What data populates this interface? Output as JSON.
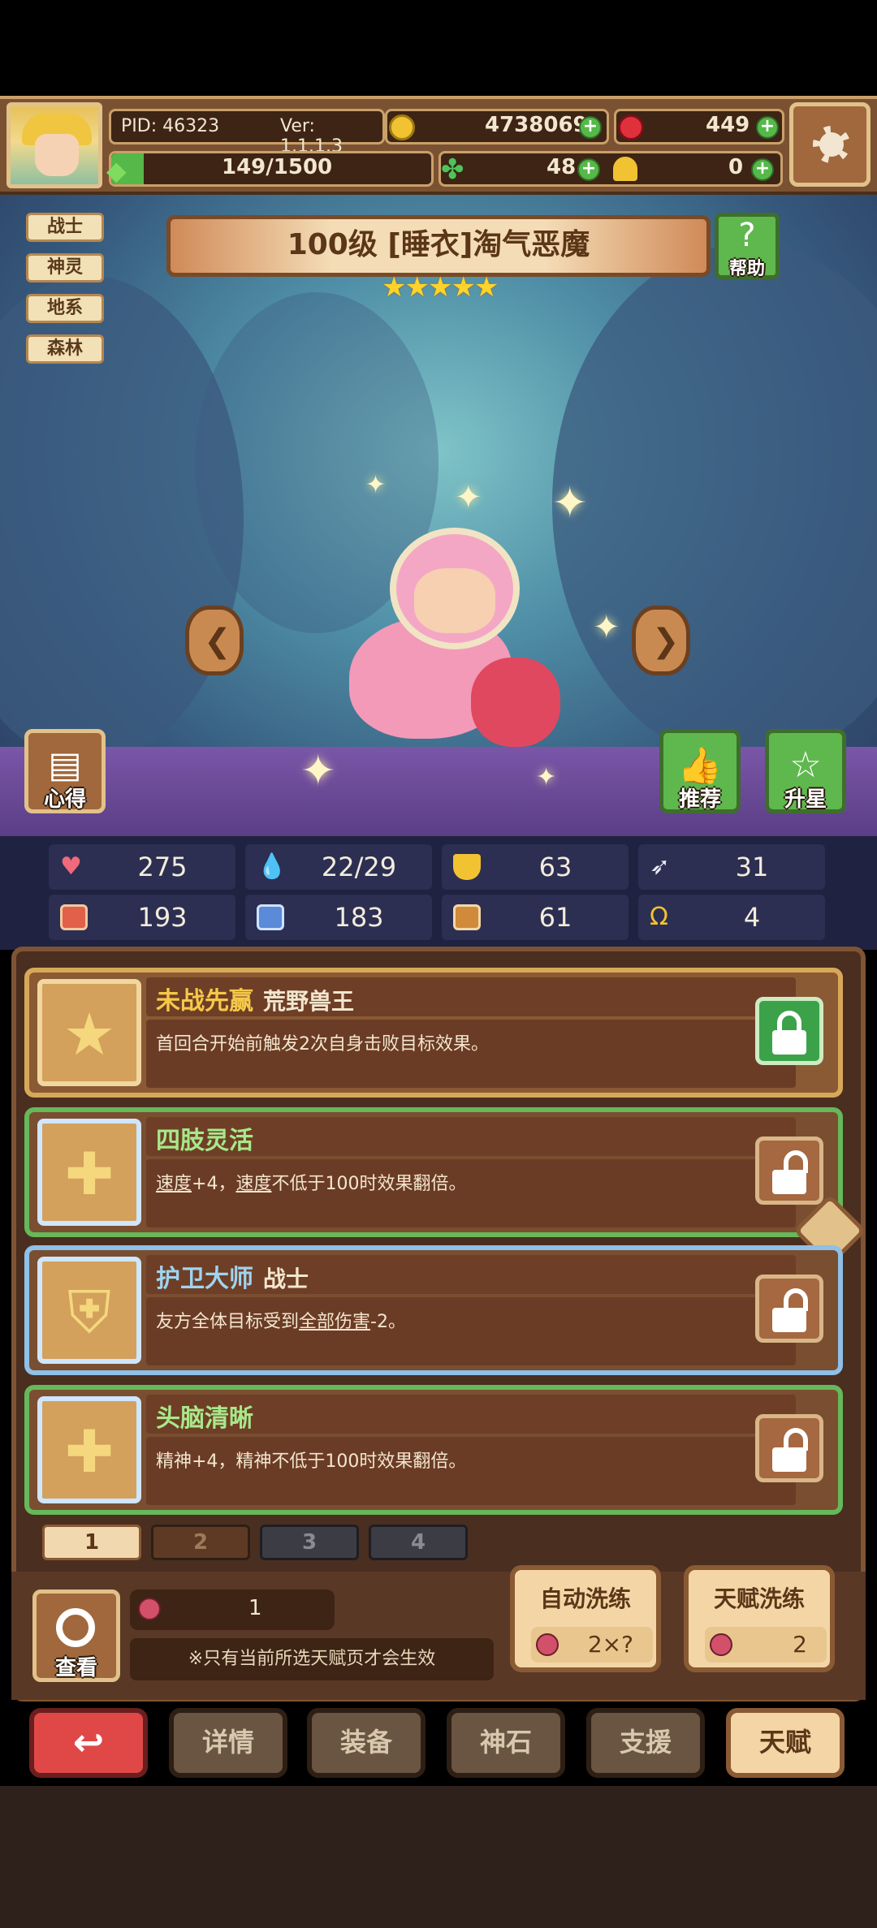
{
  "status": {
    "pid": "PID: 46323",
    "version": "Ver: 1.1.1.3",
    "gold": "4738069",
    "gems": "449",
    "stamina": "149/1500",
    "clover": "48",
    "key": "0"
  },
  "tags": [
    "战士",
    "神灵",
    "地系",
    "森林"
  ],
  "hero": {
    "title": "100级  [睡衣]淘气恶魔",
    "stars": "★★★★★"
  },
  "buttons": {
    "help": "帮助",
    "tips": "心得",
    "recommend": "推荐",
    "star_up": "升星",
    "view": "查看"
  },
  "stats": {
    "hp": "275",
    "mana": "22/29",
    "defense": "63",
    "speed": "31",
    "attack": "193",
    "spirit": "183",
    "magic_def": "61",
    "crit": "4"
  },
  "talents": [
    {
      "name": "未战先赢",
      "sub": "荒野兽王",
      "desc": "首回合开始前触发2次自身击败目标效果。",
      "name_color": "#f5c84a"
    },
    {
      "name": "四肢灵活",
      "sub": "",
      "desc_parts": [
        "速度",
        "+4，",
        "速度",
        "不低于100时效果翻倍。"
      ],
      "name_color": "#a8e88a"
    },
    {
      "name": "护卫大师",
      "sub": "战士",
      "desc_parts": [
        "友方全体目标受到",
        "全部伤害",
        "-2。"
      ],
      "name_color": "#9fd4f2"
    },
    {
      "name": "头脑清晰",
      "sub": "",
      "desc": "精神+4，精神不低于100时效果翻倍。",
      "name_color": "#a8e88a"
    }
  ],
  "pages": [
    "1",
    "2",
    "3",
    "4"
  ],
  "wash": {
    "resource_count": "1",
    "note": "※只有当前所选天赋页才会生效",
    "auto": {
      "label": "自动洗练",
      "cost": "2×?"
    },
    "talent": {
      "label": "天赋洗练",
      "cost": "2"
    }
  },
  "nav": {
    "details": "详情",
    "equip": "装备",
    "stone": "神石",
    "support": "支援",
    "talent": "天赋"
  },
  "colors": {
    "accent_gold": "#f5c84a",
    "green": "#5fb84e",
    "panel": "#4a2e20"
  }
}
